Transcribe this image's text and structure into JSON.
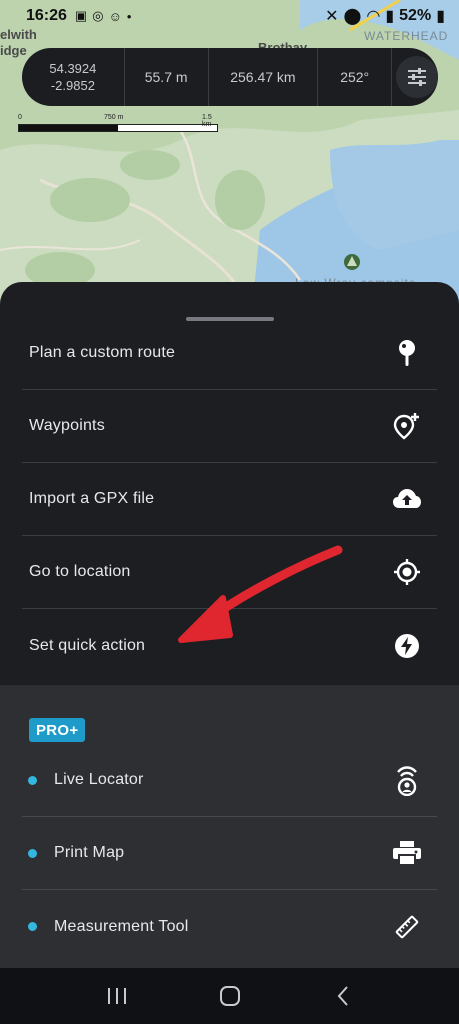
{
  "status_bar": {
    "time": "16:26",
    "battery": "52%"
  },
  "map": {
    "labels": [
      "elwith",
      "idge",
      "Brothay",
      "WATERHEAD",
      "Low Wray campsite"
    ],
    "scale": {
      "ticks": [
        "0",
        "750 m",
        "1.5 km"
      ]
    }
  },
  "stats": {
    "latitude": "54.3924",
    "longitude": "-2.9852",
    "altitude": "55.7 m",
    "distance": "256.47 km",
    "bearing": "252°"
  },
  "menu": {
    "items": [
      {
        "label": "Plan a custom route",
        "icon": "pin-icon"
      },
      {
        "label": "Waypoints",
        "icon": "add-location-icon"
      },
      {
        "label": "Import a GPX file",
        "icon": "cloud-upload-icon"
      },
      {
        "label": "Go to location",
        "icon": "crosshair-icon"
      },
      {
        "label": "Set quick action",
        "icon": "lightning-icon"
      }
    ]
  },
  "pro": {
    "badge": "PRO+",
    "items": [
      {
        "label": "Live Locator",
        "icon": "live-locator-icon"
      },
      {
        "label": "Print Map",
        "icon": "printer-icon"
      },
      {
        "label": "Measurement Tool",
        "icon": "ruler-icon"
      }
    ]
  },
  "colors": {
    "accent": "#1f9bc9",
    "dot": "#35b6df",
    "annotation_arrow": "#e0262f",
    "sheet": "#1c1e22",
    "pro_section": "#2d2f33"
  }
}
